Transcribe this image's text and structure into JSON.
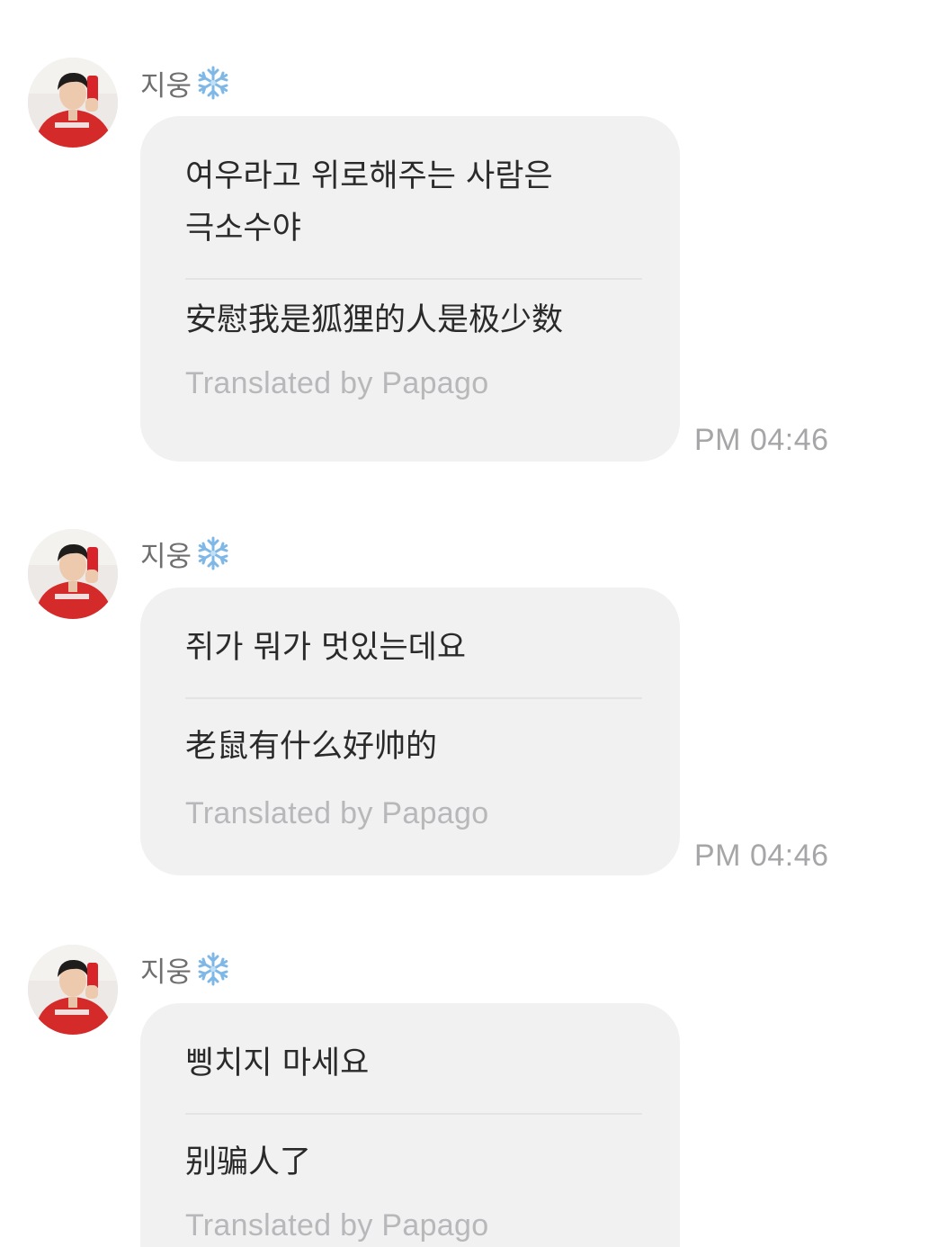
{
  "messages": [
    {
      "sender": "지웅",
      "original": "여우라고 위로해주는 사람은\n극소수야",
      "translation": "安慰我是狐狸的人是极少数",
      "credit": "Translated by Papago",
      "time": "PM 04:46"
    },
    {
      "sender": "지웅",
      "original": "쥐가 뭐가 멋있는데요",
      "translation": "老鼠有什么好帅的",
      "credit": "Translated by Papago",
      "time": "PM 04:46"
    },
    {
      "sender": "지웅",
      "original": "삥치지 마세요",
      "translation": "别骗人了",
      "credit": "Translated by Papago",
      "time": ""
    }
  ],
  "icons": {
    "sender_badge": "snowflake-icon",
    "avatar": "profile-photo"
  },
  "colors": {
    "bubble": "#f1f1f2",
    "timestamp": "#a6a6a9",
    "credit": "#b8b8bb",
    "snowflake": "#7fb8e6"
  }
}
